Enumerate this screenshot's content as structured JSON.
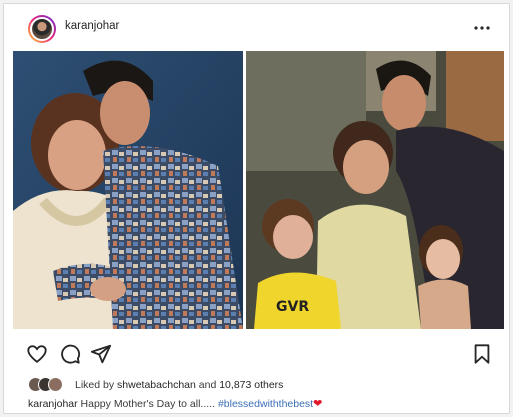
{
  "post": {
    "username": "karanjohar",
    "likes": {
      "prefix": "Liked by",
      "user": "shwetabachchan",
      "and": "and",
      "count": "10,873 others"
    },
    "caption": {
      "username": "karanjohar",
      "text": "Happy Mother's Day to all.....",
      "hashtag": "#blessedwiththebest",
      "emoji": "❤"
    },
    "icons": {
      "more": "more-options-icon",
      "like": "heart-icon",
      "comment": "comment-icon",
      "share": "share-icon",
      "save": "bookmark-icon"
    }
  },
  "colors": {
    "text": "#262626",
    "hashtag": "#3b6fb6",
    "heart": "#e3162a",
    "background": "#ffffff"
  }
}
